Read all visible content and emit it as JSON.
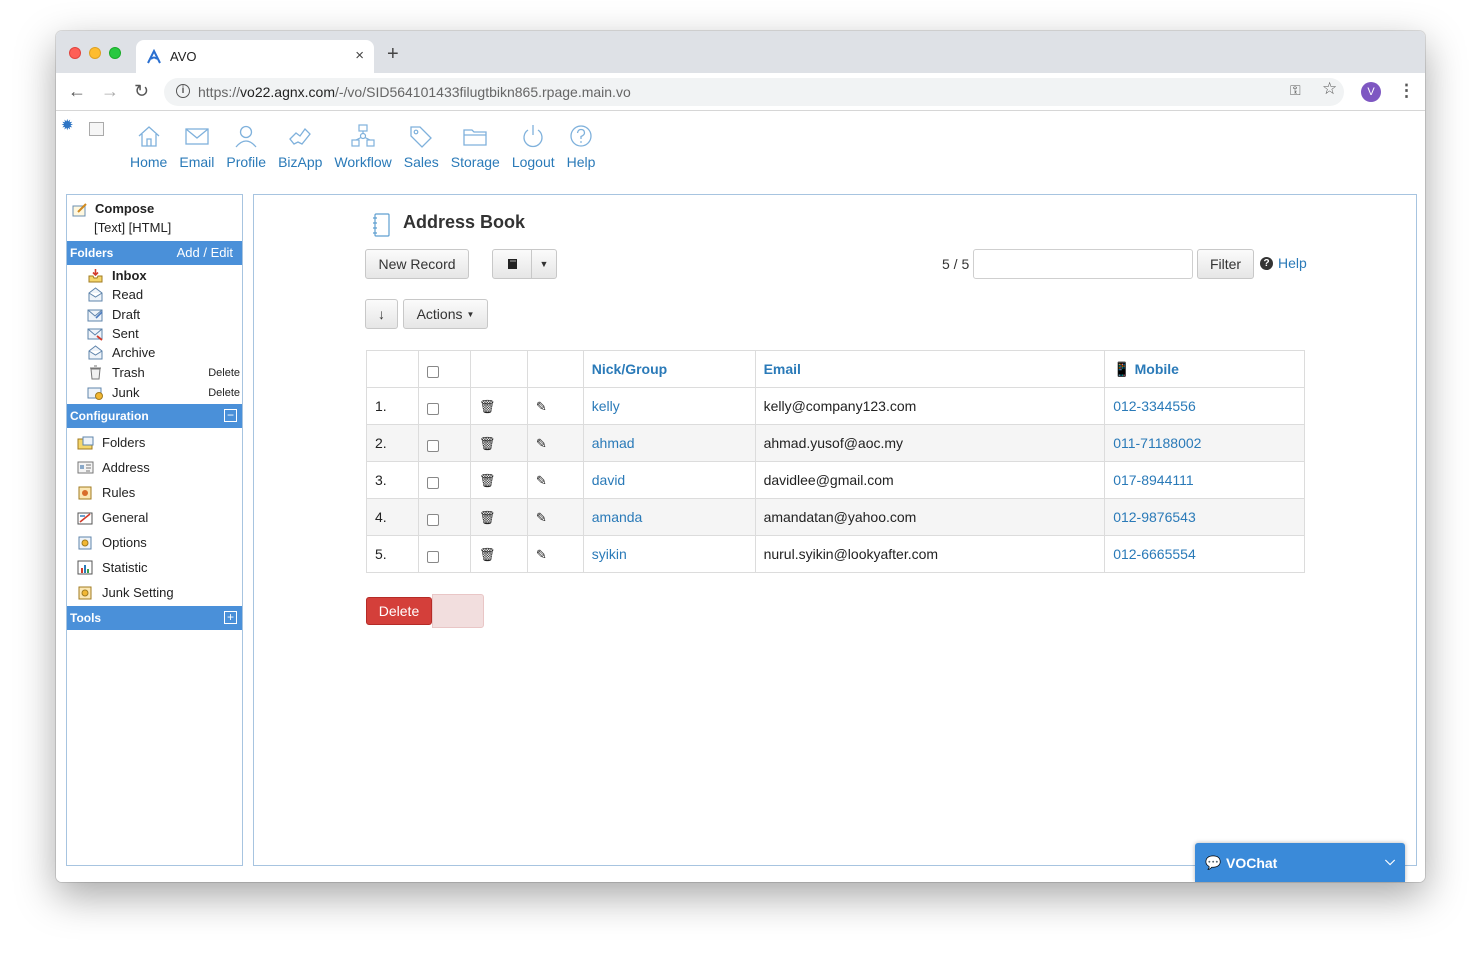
{
  "browser": {
    "tab_title": "AVO",
    "tab_close": "×",
    "new_tab": "+",
    "url_prefix": "https://",
    "url_host": "vo22.agnx.com",
    "url_path": "/-/vo/SID564101433filugtbikn865.rpage.main.vo",
    "avatar_letter": "V"
  },
  "topnav": [
    {
      "label": "Home",
      "icon": "home-icon"
    },
    {
      "label": "Email",
      "icon": "envelope-icon"
    },
    {
      "label": "Profile",
      "icon": "person-icon"
    },
    {
      "label": "BizApp",
      "icon": "handshake-icon"
    },
    {
      "label": "Workflow",
      "icon": "workflow-icon"
    },
    {
      "label": "Sales",
      "icon": "tag-icon"
    },
    {
      "label": "Storage",
      "icon": "folder-icon"
    },
    {
      "label": "Logout",
      "icon": "power-icon"
    },
    {
      "label": "Help",
      "icon": "question-icon"
    }
  ],
  "sidebar": {
    "compose_title": "Compose",
    "compose_sub": "[Text] [HTML]",
    "folders_header": "Folders",
    "folders_action": "Add / Edit",
    "folders": [
      {
        "label": "Inbox",
        "bold": true,
        "action": ""
      },
      {
        "label": "Read",
        "action": ""
      },
      {
        "label": "Draft",
        "action": ""
      },
      {
        "label": "Sent",
        "action": ""
      },
      {
        "label": "Archive",
        "action": ""
      },
      {
        "label": "Trash",
        "action": "Delete"
      },
      {
        "label": "Junk",
        "action": "Delete"
      }
    ],
    "config_header": "Configuration",
    "config_toggle": "−",
    "config_items": [
      "Folders",
      "Address",
      "Rules",
      "General",
      "Options",
      "Statistic",
      "Junk Setting"
    ],
    "tools_header": "Tools",
    "tools_toggle": "+"
  },
  "main": {
    "title": "Address Book",
    "new_record": "New Record",
    "actions": "Actions",
    "count": "5 / 5",
    "filter_value": "",
    "filter_button": "Filter",
    "help": "Help",
    "sort_arrow": "↓",
    "columns": {
      "nick": "Nick/Group",
      "email": "Email",
      "mobile": "Mobile"
    },
    "rows": [
      {
        "num": "1.",
        "nick": "kelly",
        "email": "kelly@company123.com",
        "mobile": "012-3344556"
      },
      {
        "num": "2.",
        "nick": "ahmad",
        "email": "ahmad.yusof@aoc.my",
        "mobile": "011-71188002"
      },
      {
        "num": "3.",
        "nick": "david",
        "email": "davidlee@gmail.com",
        "mobile": "017-8944111"
      },
      {
        "num": "4.",
        "nick": "amanda",
        "email": "amandatan@yahoo.com",
        "mobile": "012-9876543"
      },
      {
        "num": "5.",
        "nick": "syikin",
        "email": "nurul.syikin@lookyafter.com",
        "mobile": "012-6665554"
      }
    ],
    "delete_button": "Delete"
  },
  "vochat": {
    "label": "VOChat"
  },
  "colors": {
    "accent": "#2a7ab8",
    "header_blue": "#4a90d9",
    "danger": "#d43f3a"
  }
}
